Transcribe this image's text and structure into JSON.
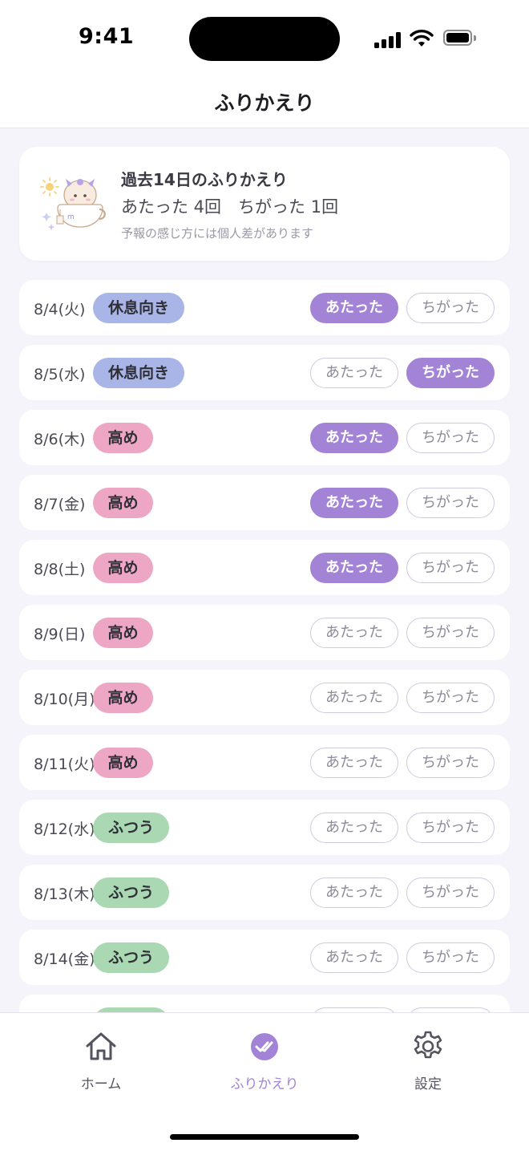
{
  "status_bar": {
    "time": "9:41"
  },
  "header": {
    "title": "ふりかえり"
  },
  "summary": {
    "title": "過去14日のふりかえり",
    "counts": "あたった 4回　ちがった 1回",
    "note": "予報の感じ方には個人差があります"
  },
  "vote_labels": {
    "hit": "あたった",
    "miss": "ちがった"
  },
  "rows": [
    {
      "date": "8/4(火)",
      "level": "休息向き",
      "kind": "rest",
      "vote": "hit"
    },
    {
      "date": "8/5(水)",
      "level": "休息向き",
      "kind": "rest",
      "vote": "miss"
    },
    {
      "date": "8/6(木)",
      "level": "高め",
      "kind": "high",
      "vote": "hit"
    },
    {
      "date": "8/7(金)",
      "level": "高め",
      "kind": "high",
      "vote": "hit"
    },
    {
      "date": "8/8(土)",
      "level": "高め",
      "kind": "high",
      "vote": "hit"
    },
    {
      "date": "8/9(日)",
      "level": "高め",
      "kind": "high",
      "vote": "none"
    },
    {
      "date": "8/10(月)",
      "level": "高め",
      "kind": "high",
      "vote": "none"
    },
    {
      "date": "8/11(火)",
      "level": "高め",
      "kind": "high",
      "vote": "none"
    },
    {
      "date": "8/12(水)",
      "level": "ふつう",
      "kind": "normal",
      "vote": "none"
    },
    {
      "date": "8/13(木)",
      "level": "ふつう",
      "kind": "normal",
      "vote": "none"
    },
    {
      "date": "8/14(金)",
      "level": "ふつう",
      "kind": "normal",
      "vote": "none"
    },
    {
      "date": "",
      "level": "",
      "kind": "normal",
      "vote": "none"
    }
  ],
  "tabs": [
    {
      "label": "ホーム",
      "icon": "house-icon",
      "active": false
    },
    {
      "label": "ふりかえり",
      "icon": "checkmark-icon",
      "active": true
    },
    {
      "label": "設定",
      "icon": "gear-icon",
      "active": false
    }
  ],
  "colors": {
    "accent": "#a283d6",
    "rest": "#a8b5e6",
    "high": "#eea6c5",
    "normal": "#a9d8b2",
    "background": "#f6f4fb"
  }
}
